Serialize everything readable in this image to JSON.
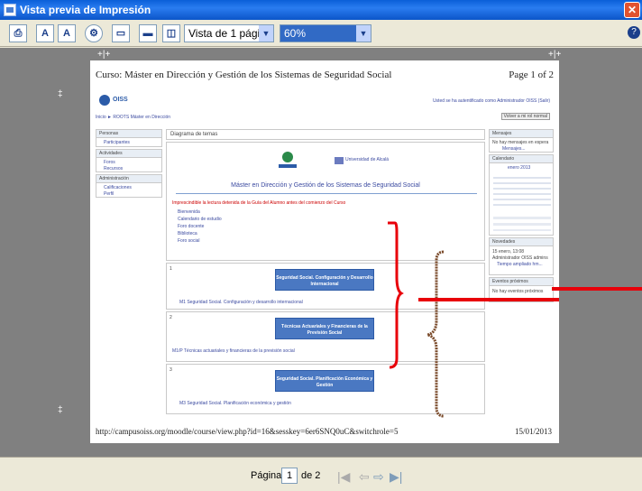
{
  "window": {
    "title": "Vista previa de Impresión"
  },
  "toolbar": {
    "view_mode": "Vista de 1 página",
    "zoom": "60%"
  },
  "page": {
    "header_title": "Curso: Máster en Dirección y Gestión de los Sistemas de Seguridad Social",
    "page_of": "Page 1 of 2",
    "footer_url": "http://campusoiss.org/moodle/course/view.php?id=16&sesskey=6er6SNQ0uC&switchrole=5",
    "footer_date": "15/01/2013",
    "logo_text": "OISS",
    "logged_in": "Usted se ha autentificado como Administrador OISS (Salir)",
    "breadcrumb": "Inicio ► ROOTS Máster en Dirección",
    "return_role": "Volver a mi rol normal",
    "section_title": "Diagrama de temas",
    "univ": "Universidad de Alcalá",
    "main_heading": "Máster en Dirección y Gestión de los Sistemas de Seguridad Social",
    "red_note": "Imprescindible la lectura detenida de la Guía del Alumno antes del comienzo del Curso",
    "resources": [
      "Bienvenida",
      "Calendario de estudio",
      "Foro docente",
      "Biblioteca",
      "Foro social"
    ],
    "topics": [
      {
        "num": "1",
        "button": "Seguridad Social. Configuración y Desarrollo Internacional",
        "link": "M1 Seguridad Social. Configuración y desarrollo internacional"
      },
      {
        "num": "2",
        "button": "Técnicas Actuariales y Financieras de la Previsión Social",
        "link": "M1/P Técnicas actuariales y financieras de la previsión social"
      },
      {
        "num": "3",
        "button": "Seguridad Social. Planificación Económica y Gestión",
        "link": "M3 Seguridad Social. Planificación económica y gestión"
      }
    ],
    "left_blocks": [
      {
        "title": "Personas",
        "items": [
          "Participantes"
        ]
      },
      {
        "title": "Actividades",
        "items": [
          "Foros",
          "Recursos"
        ]
      },
      {
        "title": "Administración",
        "items": [
          "Calificaciones",
          "Perfil"
        ]
      }
    ],
    "right_blocks": [
      {
        "title": "Mensajes",
        "items": [
          "No hay mensajes en espera",
          "Mensajes..."
        ]
      },
      {
        "title": "Calendario",
        "items": [
          "enero 2013"
        ]
      },
      {
        "title": "Novedades",
        "items": [
          "15 enero, 13:08",
          "Administrador OISS admins",
          "Tiempo ampliado hm..."
        ]
      },
      {
        "title": "Eventos próximos",
        "items": [
          "No hay eventos próximos"
        ]
      }
    ]
  },
  "status": {
    "page_label": "Página",
    "page_num": "1",
    "page_total": "de 2"
  },
  "colors": {
    "annotation_red": "#e8000a",
    "title_blue": "#0b55c8"
  }
}
